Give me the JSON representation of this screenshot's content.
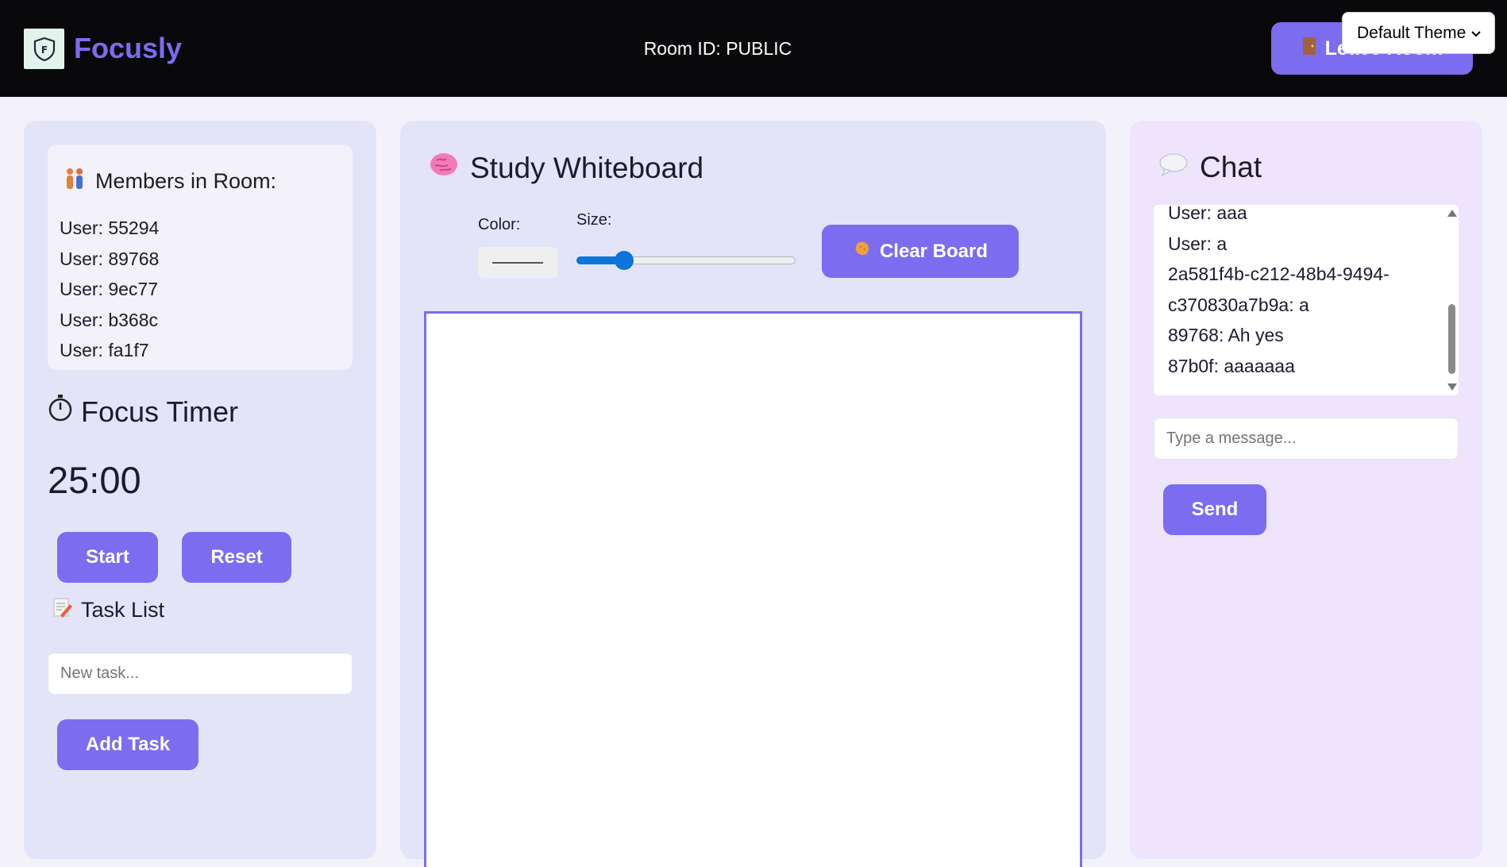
{
  "header": {
    "brand": "Focusly",
    "room_id": "Room ID: PUBLIC",
    "leave_label": "Leave Room",
    "theme_selected": "Default Theme"
  },
  "members": {
    "title": "Members in Room:",
    "items": [
      "User: 55294",
      "User: 89768",
      "User: 9ec77",
      "User: b368c",
      "User: fa1f7"
    ]
  },
  "timer": {
    "title": "Focus Timer",
    "value": "25:00",
    "start_label": "Start",
    "reset_label": "Reset"
  },
  "tasks": {
    "title": "Task List",
    "placeholder": "New task...",
    "add_label": "Add Task"
  },
  "whiteboard": {
    "title": "Study Whiteboard",
    "color_label": "Color:",
    "size_label": "Size:",
    "size_value_fraction": 0.19,
    "clear_label": "Clear Board"
  },
  "chat": {
    "title": "Chat",
    "messages": [
      "User: aaa",
      "User: a",
      "2a581f4b-c212-48b4-9494-",
      "c370830a7b9a: a",
      "89768: Ah yes",
      "87b0f: aaaaaaa"
    ],
    "placeholder": "Type a message...",
    "send_label": "Send"
  },
  "colors": {
    "accent": "#7c6cf0",
    "topbar": "#09090b",
    "panel": "#e4e4f8",
    "chat_panel": "#eee4fc"
  },
  "icons": {
    "logo": "shield-f-icon",
    "leave": "door-icon",
    "members": "people-icon",
    "timer": "stopwatch-icon",
    "tasks": "memo-icon",
    "whiteboard": "brain-icon",
    "clear": "sponge-icon",
    "chat": "speech-bubble-icon"
  }
}
